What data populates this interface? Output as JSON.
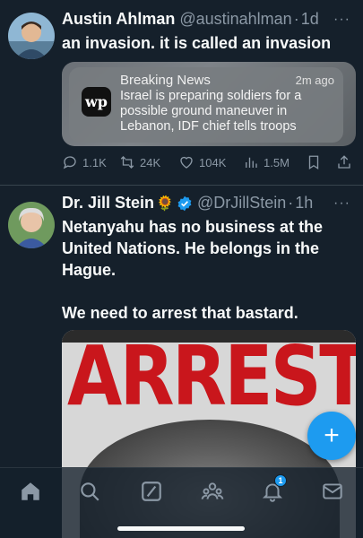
{
  "tweets": [
    {
      "name": "Austin Ahlman",
      "handle": "@austinahlman",
      "time": "1d",
      "text": "an invasion. it is called an invasion",
      "card": {
        "title": "Breaking News",
        "time": "2m ago",
        "text": "Israel is preparing soldiers for a possible ground maneuver in Lebanon, IDF chief tells troops",
        "logo": "wp"
      },
      "actions": {
        "replies": "1.1K",
        "reposts": "24K",
        "likes": "104K",
        "views": "1.5M"
      }
    },
    {
      "name": "Dr. Jill Stein",
      "emoji": "🌻",
      "handle": "@DrJillStein",
      "time": "1h",
      "text_lines": [
        "Netanyahu has no business at the United Nations. He belongs in the Hague.",
        "We need to arrest that bastard."
      ],
      "image_text": "ARREST"
    }
  ],
  "more_label": "···",
  "dot": "·",
  "fab_label": "+",
  "notifications_badge": "1",
  "colors": {
    "background": "#15202b",
    "accent": "#1d9bf0",
    "secondary_text": "#8b98a5",
    "divider": "#38444d"
  },
  "icons": [
    "reply-icon",
    "repost-icon",
    "like-icon",
    "views-icon",
    "bookmark-icon",
    "share-icon",
    "home-icon",
    "search-icon",
    "grok-icon",
    "communities-icon",
    "notifications-icon",
    "messages-icon"
  ]
}
